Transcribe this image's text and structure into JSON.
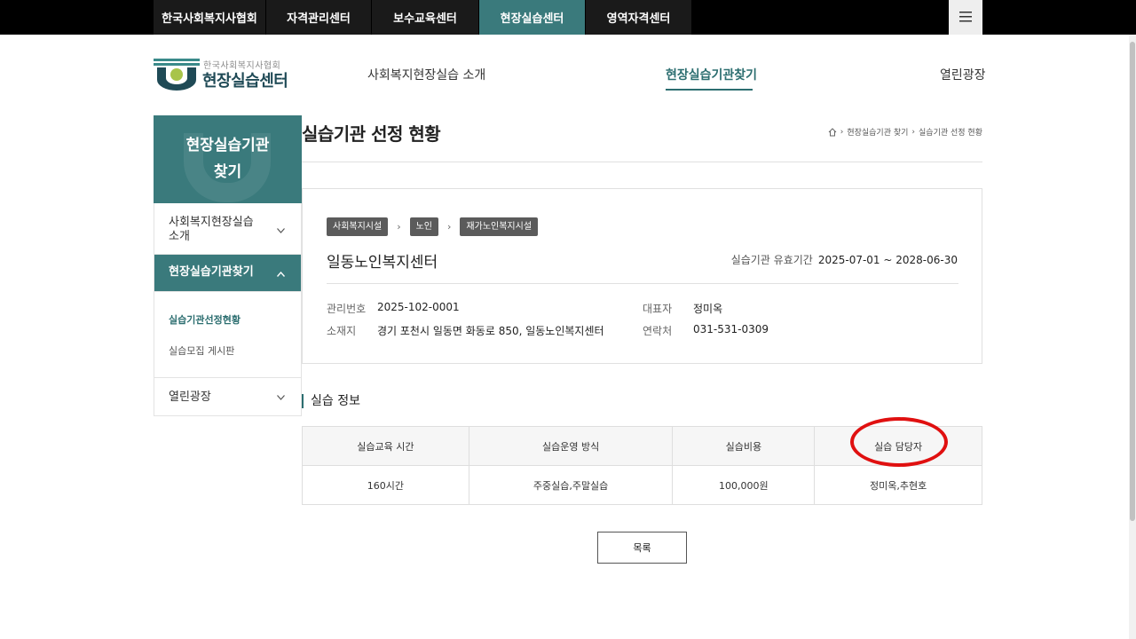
{
  "top_nav": [
    {
      "label": "한국사회복지사협회",
      "active": false
    },
    {
      "label": "자격관리센터",
      "active": false
    },
    {
      "label": "보수교육센터",
      "active": false
    },
    {
      "label": "현장실습센터",
      "active": true
    },
    {
      "label": "영역자격센터",
      "active": false
    }
  ],
  "menu_icon": "hamburger-icon",
  "logo": {
    "sub": "한국사회복지사협회",
    "main": "현장실습센터"
  },
  "gnb": {
    "intro": "사회복지현장실습 소개",
    "find": "현장실습기관찾기",
    "plaza": "열린광장"
  },
  "sidebar": {
    "title_line1": "현장실습기관",
    "title_line2": "찾기",
    "items": [
      {
        "label": "사회복지현장실습 소개"
      },
      {
        "label": "현장실습기관찾기"
      },
      {
        "label": "열린광장"
      }
    ],
    "sub_items": [
      {
        "label": "실습기관선정현황"
      },
      {
        "label": "실습모집 게시판"
      }
    ]
  },
  "page": {
    "title": "실습기관 선정 현황",
    "breadcrumb": [
      "현장실습기관 찾기",
      "실습기관 선정 현황"
    ]
  },
  "card": {
    "tags": [
      "사회복지시설",
      "노인",
      "재가노인복지시설"
    ],
    "org_name": "일동노인복지센터",
    "validity_label": "실습기관 유효기간",
    "validity_value": "2025-07-01 ~ 2028-06-30",
    "mgmt_no_label": "관리번호",
    "mgmt_no": "2025-102-0001",
    "address_label": "소재지",
    "address": "경기 포천시 일동면 화동로 850, 일동노인복지센터",
    "rep_label": "대표자",
    "rep": "정미옥",
    "contact_label": "연락처",
    "contact": "031-531-0309"
  },
  "practice": {
    "section_title": "실습 정보",
    "headers": [
      "실습교육 시간",
      "실습운영 방식",
      "실습비용",
      "실습 담당자"
    ],
    "row": [
      "160시간",
      "주중실습,주말실습",
      "100,000원",
      "정미옥,추현호"
    ]
  },
  "list_button": "목록",
  "colors": {
    "accent": "#3a7a7c",
    "annotation": "#e01010"
  }
}
